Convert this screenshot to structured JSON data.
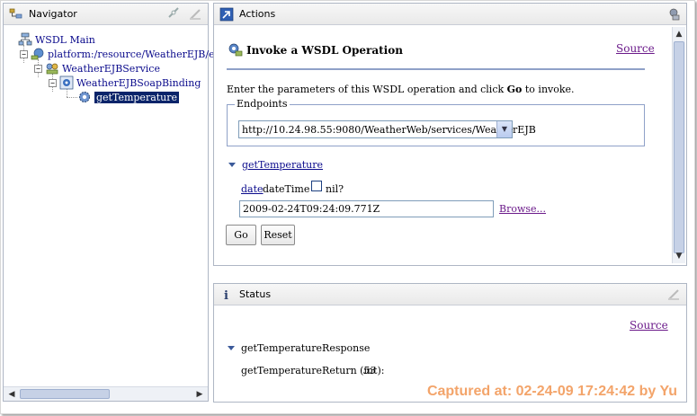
{
  "navigator": {
    "title": "Navigator",
    "tree": [
      {
        "label": "WSDL Main",
        "icon": "wsdl-main-icon"
      },
      {
        "label": "platform:/resource/WeatherEJB/ejbM",
        "icon": "platform-icon"
      },
      {
        "label": "WeatherEJBService",
        "icon": "service-icon"
      },
      {
        "label": "WeatherEJBSoapBinding",
        "icon": "binding-icon"
      },
      {
        "label": "getTemperature",
        "icon": "operation-icon",
        "selected": true
      }
    ],
    "expander_symbol": "−"
  },
  "actions": {
    "title": "Actions",
    "operation_title": "Invoke a WSDL Operation",
    "source_label": "Source",
    "intro_prefix": "Enter the parameters of this WSDL operation and click ",
    "intro_bold": "Go",
    "intro_suffix": " to invoke.",
    "endpoints_legend": "Endpoints",
    "endpoint_selected": "http://10.24.98.55:9080/WeatherWeb/services/WeatherEJB",
    "operation_name": "getTemperature",
    "param_name": "date",
    "param_type": "dateTime",
    "nil_label": "nil?",
    "date_value": "2009-02-24T09:24:09.771Z",
    "browse_label": "Browse...",
    "go_label": "Go",
    "reset_label": "Reset"
  },
  "status": {
    "title": "Status",
    "source_label": "Source",
    "response_name": "getTemperatureResponse",
    "return_label": "getTemperatureReturn (int):",
    "return_value": "53"
  },
  "watermark": "Captured at: 02-24-09 17:24:42 by Yu",
  "colors": {
    "link": "#0b0b8c",
    "visited_link": "#6b1a8a",
    "selection": "#0a246a",
    "watermark": "#f3a46a"
  }
}
